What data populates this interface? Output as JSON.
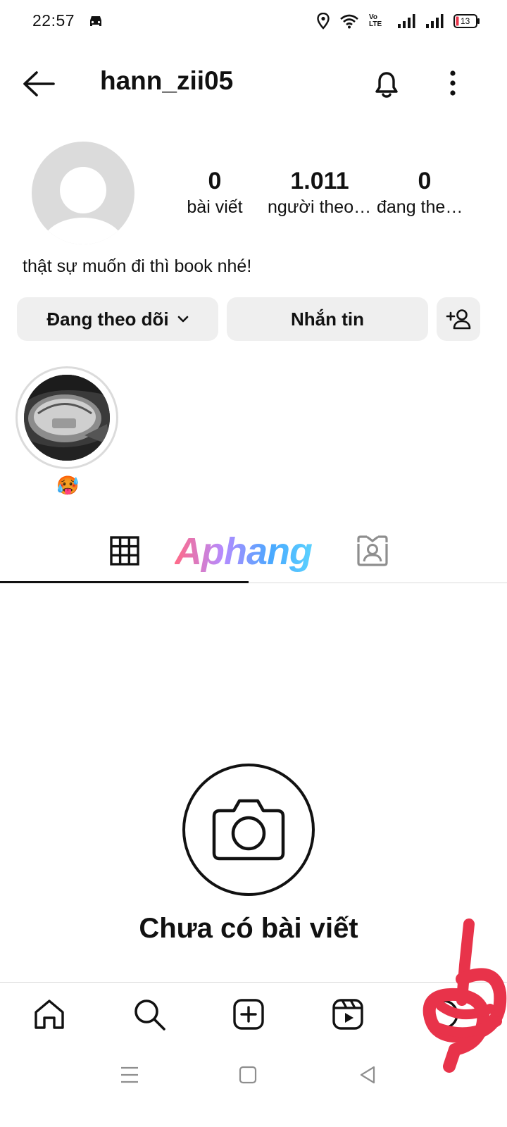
{
  "status_bar": {
    "time": "22:57",
    "network_label": "Vo LTE",
    "battery_level": "13"
  },
  "header": {
    "username": "hann_zii05"
  },
  "profile": {
    "stats": [
      {
        "value": "0",
        "label": "bài viết"
      },
      {
        "value": "1.011",
        "label": "người theo dõi"
      },
      {
        "value": "0",
        "label": "đang theo dõi"
      }
    ],
    "bio": "thật sự muốn đi thì book nhé!"
  },
  "actions": {
    "following_label": "Đang theo dõi",
    "message_label": "Nhắn tin"
  },
  "highlight": {
    "label": "🥵"
  },
  "tabs": {
    "watermark": "Aphang",
    "active": "grid"
  },
  "empty_state": {
    "title": "Chưa có bài viết"
  },
  "colors": {
    "divider": "#dbdbdb",
    "button_bg": "#efefef",
    "annotation_red": "#e8334a"
  },
  "icons": {
    "header": [
      "back-arrow-icon",
      "bell-icon",
      "more-vertical-icon"
    ],
    "bottom_nav": [
      "home-icon",
      "search-icon",
      "create-post-icon",
      "reels-icon",
      "profile-icon"
    ],
    "system_nav": [
      "menu-icon",
      "square-icon",
      "back-triangle-icon"
    ]
  }
}
